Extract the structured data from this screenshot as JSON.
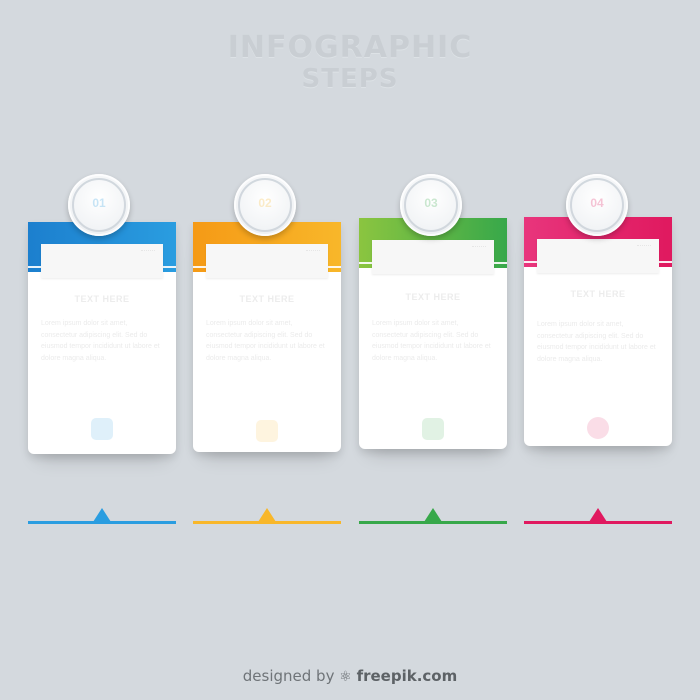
{
  "header": {
    "title_line1": "INFOGRAPHIC",
    "title_line2": "STEPS"
  },
  "steps": [
    {
      "number": "01",
      "title": "TEXT HERE",
      "body": "Lorem ipsum dolor sit amet, consectetur adipiscing elit. Sed do eiusmod tempor incididunt ut labore et dolore magna aliqua.",
      "color": "#2a9de0",
      "color2": "#1c7fce",
      "icon": "document-icon"
    },
    {
      "number": "02",
      "title": "TEXT HERE",
      "body": "Lorem ipsum dolor sit amet, consectetur adipiscing elit. Sed do eiusmod tempor incididunt ut labore et dolore magna aliqua.",
      "color": "#f8b72a",
      "color2": "#f59a16",
      "icon": "chat-icon"
    },
    {
      "number": "03",
      "title": "TEXT HERE",
      "body": "Lorem ipsum dolor sit amet, consectetur adipiscing elit. Sed do eiusmod tempor incididunt ut labore et dolore magna aliqua.",
      "color": "#37a84a",
      "color2": "#8bc540",
      "icon": "cart-icon"
    },
    {
      "number": "04",
      "title": "TEXT HERE",
      "body": "Lorem ipsum dolor sit amet, consectetur adipiscing elit. Sed do eiusmod tempor incididunt ut labore et dolore magna aliqua.",
      "color": "#e0195f",
      "color2": "#e8357c",
      "icon": "circle-icon"
    }
  ],
  "footer": {
    "prefix": "designed by",
    "brand": "freepik.com"
  }
}
